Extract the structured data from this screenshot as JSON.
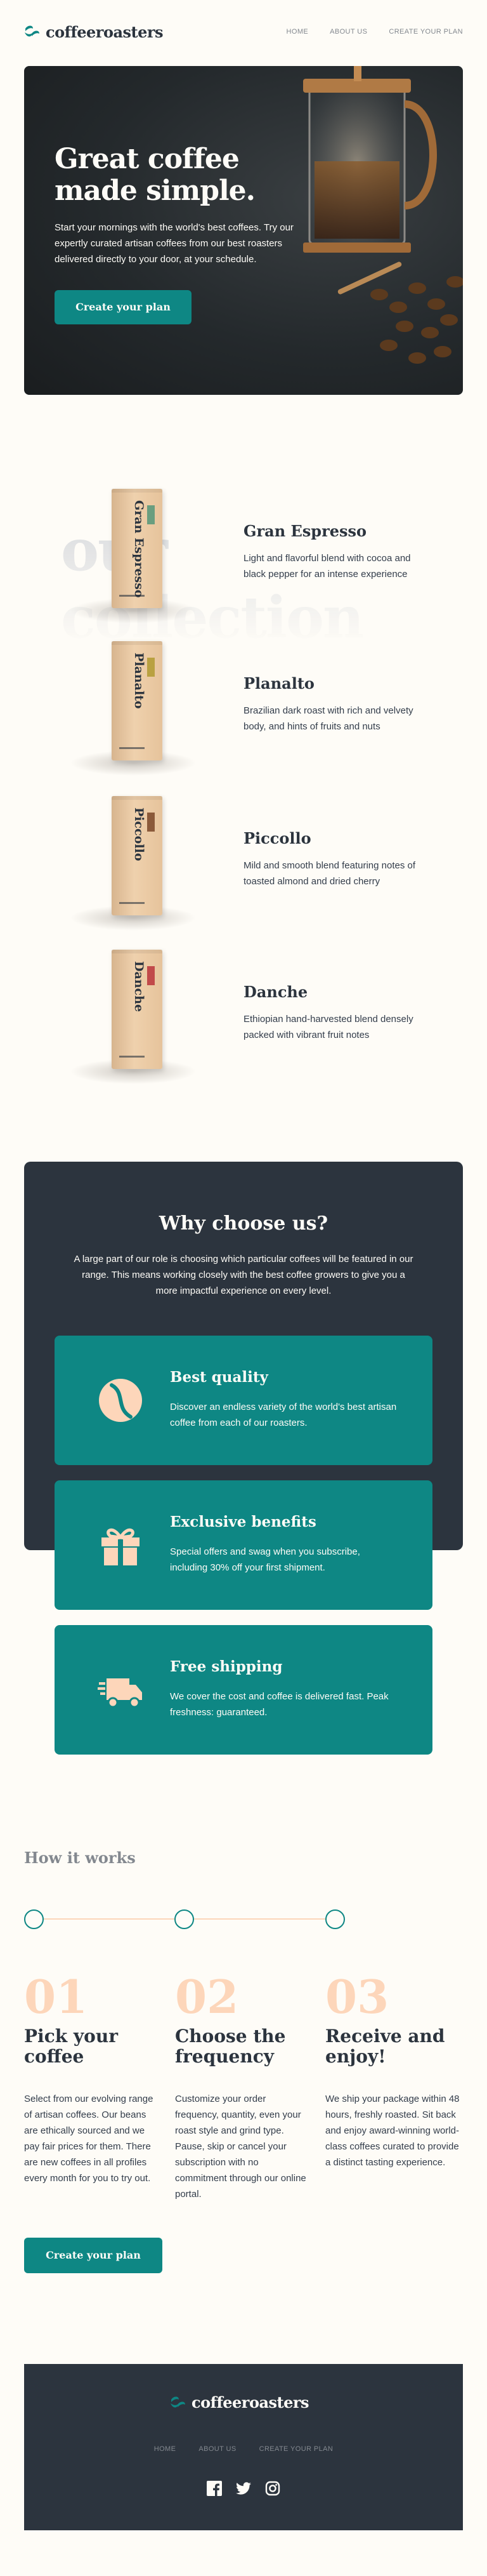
{
  "header": {
    "logo": "coffeeroasters",
    "nav": [
      "HOME",
      "ABOUT US",
      "CREATE YOUR PLAN"
    ]
  },
  "hero": {
    "title": "Great coffee made simple.",
    "text": "Start your mornings with the world's best coffees. Try our expertly curated artisan coffees from our best roasters delivered directly to your door, at your schedule.",
    "cta": "Create your plan"
  },
  "collection": {
    "heading": "our collection",
    "items": [
      {
        "name": "Gran Espresso",
        "bag_label": "Gran Espresso",
        "desc": "Light and flavorful blend with cocoa and black pepper for an intense experience",
        "accent": "#6A9E7F"
      },
      {
        "name": "Planalto",
        "bag_label": "Planalto",
        "desc": "Brazilian dark roast with rich and velvety body, and hints of fruits and nuts",
        "accent": "#B9A141"
      },
      {
        "name": "Piccollo",
        "bag_label": "Piccollo",
        "desc": "Mild and smooth blend featuring notes of toasted almond and dried cherry",
        "accent": "#8B5A3A"
      },
      {
        "name": "Danche",
        "bag_label": "Danche",
        "desc": "Ethiopian hand-harvested blend densely packed with vibrant fruit notes",
        "accent": "#C14A4A"
      }
    ]
  },
  "why": {
    "title": "Why choose us?",
    "text": "A large part of our role is choosing which particular coffees will be featured in our range. This means working closely with the best coffee growers to give you a more impactful experience on every level.",
    "benefits": [
      {
        "title": "Best quality",
        "text": "Discover an endless variety of the world's best artisan coffee from each of our roasters.",
        "icon": "coffee-bean-icon"
      },
      {
        "title": "Exclusive benefits",
        "text": "Special offers and swag when you subscribe, including 30% off your first shipment.",
        "icon": "gift-icon"
      },
      {
        "title": "Free shipping",
        "text": "We cover the cost and coffee is delivered fast. Peak freshness: guaranteed.",
        "icon": "truck-icon"
      }
    ]
  },
  "how": {
    "title": "How it works",
    "steps": [
      {
        "num": "01",
        "title": "Pick your coffee",
        "text": "Select from our evolving range of artisan coffees. Our beans are ethically sourced and we pay fair prices for them. There are new coffees in all profiles every month for you to try out."
      },
      {
        "num": "02",
        "title": "Choose the frequency",
        "text": "Customize your order frequency, quantity, even your roast style and grind type. Pause, skip or cancel your subscription with no commitment through our online portal."
      },
      {
        "num": "03",
        "title": "Receive and enjoy!",
        "text": "We ship your package within 48 hours, freshly roasted. Sit back and enjoy award-winning world-class coffees curated to provide a distinct tasting experience."
      }
    ],
    "cta": "Create your plan"
  },
  "footer": {
    "logo": "coffeeroasters",
    "nav": [
      "HOME",
      "ABOUT US",
      "CREATE YOUR PLAN"
    ],
    "social": [
      "facebook-icon",
      "twitter-icon",
      "instagram-icon"
    ]
  },
  "colors": {
    "accent": "#0E8784",
    "dark": "#2C343E",
    "cream": "#FEFCF7",
    "peach": "#FDD6BA",
    "grey": "#83888F"
  }
}
